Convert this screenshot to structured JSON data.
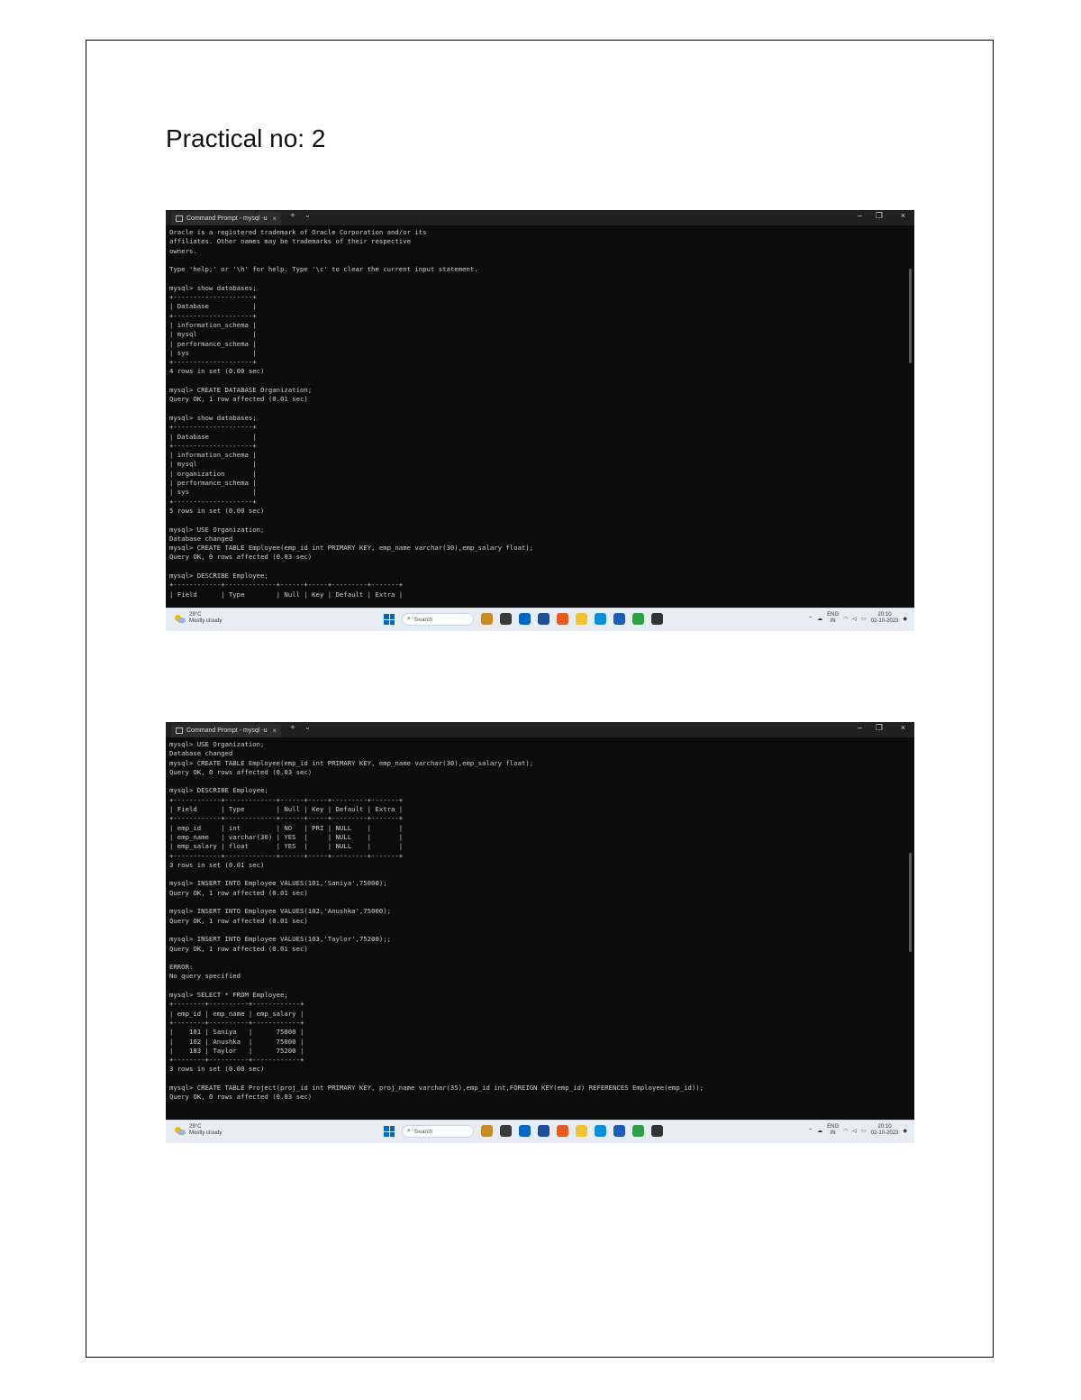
{
  "page_title": "Practical no: 2",
  "screenshots": [
    {
      "window": {
        "tab_title": "Command Prompt - mysql -u",
        "tab_close": "×",
        "new_tab": "+",
        "tab_dropdown": "⌄",
        "minimize": "–",
        "maximize": "❐",
        "close": "×"
      },
      "console_lines": [
        "Oracle is a registered trademark of Oracle Corporation and/or its",
        "affiliates. Other names may be trademarks of their respective",
        "owners.",
        "",
        "Type 'help;' or '\\h' for help. Type '\\c' to clear the current input statement.",
        "",
        "mysql> show databases;",
        "+--------------------+",
        "| Database           |",
        "+--------------------+",
        "| information_schema |",
        "| mysql              |",
        "| performance_schema |",
        "| sys                |",
        "+--------------------+",
        "4 rows in set (0.00 sec)",
        "",
        "mysql> CREATE DATABASE Organization;",
        "Query OK, 1 row affected (0.01 sec)",
        "",
        "mysql> show databases;",
        "+--------------------+",
        "| Database           |",
        "+--------------------+",
        "| information_schema |",
        "| mysql              |",
        "| organization       |",
        "| performance_schema |",
        "| sys                |",
        "+--------------------+",
        "5 rows in set (0.00 sec)",
        "",
        "mysql> USE Organization;",
        "Database changed",
        "mysql> CREATE TABLE Employee(emp_id int PRIMARY KEY, emp_name varchar(30),emp_salary float);",
        "Query OK, 0 rows affected (0.03 sec)",
        "",
        "mysql> DESCRIBE Employee;",
        "+------------+-------------+------+-----+---------+-------+",
        "| Field      | Type        | Null | Key | Default | Extra |"
      ],
      "taskbar": {
        "weather_temp": "29°C",
        "weather_desc": "Mostly cloudy",
        "search_label": "Search",
        "lang_top": "ENG",
        "lang_bottom": "IN",
        "time": "20:10",
        "date": "02-10-2023"
      }
    },
    {
      "window": {
        "tab_title": "Command Prompt - mysql -u",
        "tab_close": "×",
        "new_tab": "+",
        "tab_dropdown": "⌄",
        "minimize": "–",
        "maximize": "❐",
        "close": "×"
      },
      "console_lines": [
        "mysql> USE Organization;",
        "Database changed",
        "mysql> CREATE TABLE Employee(emp_id int PRIMARY KEY, emp_name varchar(30),emp_salary float);",
        "Query OK, 0 rows affected (0.03 sec)",
        "",
        "mysql> DESCRIBE Employee;",
        "+------------+-------------+------+-----+---------+-------+",
        "| Field      | Type        | Null | Key | Default | Extra |",
        "+------------+-------------+------+-----+---------+-------+",
        "| emp_id     | int         | NO   | PRI | NULL    |       |",
        "| emp_name   | varchar(30) | YES  |     | NULL    |       |",
        "| emp_salary | float       | YES  |     | NULL    |       |",
        "+------------+-------------+------+-----+---------+-------+",
        "3 rows in set (0.01 sec)",
        "",
        "mysql> INSERT INTO Employee VALUES(101,'Saniya',75000);",
        "Query OK, 1 row affected (0.01 sec)",
        "",
        "mysql> INSERT INTO Employee VALUES(102,'Anushka',75000);",
        "Query OK, 1 row affected (0.01 sec)",
        "",
        "mysql> INSERT INTO Employee VALUES(103,'Taylor',75200);;",
        "Query OK, 1 row affected (0.01 sec)",
        "",
        "ERROR:",
        "No query specified",
        "",
        "mysql> SELECT * FROM Employee;",
        "+--------+----------+------------+",
        "| emp_id | emp_name | emp_salary |",
        "+--------+----------+------------+",
        "|    101 | Saniya   |      75000 |",
        "|    102 | Anushka  |      75000 |",
        "|    103 | Taylor   |      75200 |",
        "+--------+----------+------------+",
        "3 rows in set (0.00 sec)",
        "",
        "mysql> CREATE TABLE Project(proj_id int PRIMARY KEY, proj_name varchar(35),emp_id int,FOREIGN KEY(emp_id) REFERENCES Employee(emp_id));",
        "Query OK, 0 rows affected (0.03 sec)"
      ],
      "taskbar": {
        "weather_temp": "29°C",
        "weather_desc": "Mostly cloudy",
        "search_label": "Search",
        "lang_top": "ENG",
        "lang_bottom": "IN",
        "time": "20:10",
        "date": "02-10-2023"
      }
    }
  ],
  "taskbar_app_colors": [
    "#c98a2a",
    "#3a3a3a",
    "#0067c0",
    "#1e4f9c",
    "#e25c24",
    "#f2c230",
    "#0a8fd8",
    "#1c5db8",
    "#2ea043",
    "#333333"
  ]
}
